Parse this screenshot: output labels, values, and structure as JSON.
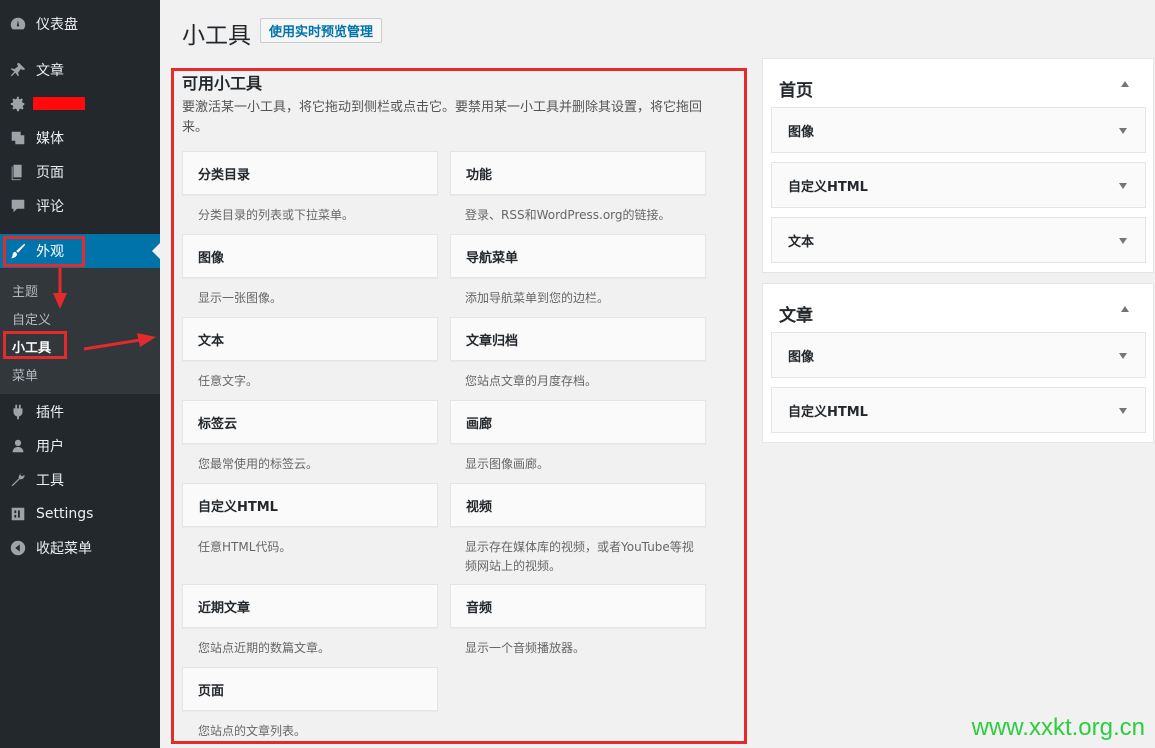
{
  "sidebar": {
    "dashboard": "仪表盘",
    "posts": "文章",
    "media": "媒体",
    "pages": "页面",
    "comments": "评论",
    "appearance": "外观",
    "plugins": "插件",
    "users": "用户",
    "tools": "工具",
    "settings": "Settings",
    "collapse": "收起菜单",
    "submenu": {
      "themes": "主题",
      "customize": "自定义",
      "widgets": "小工具",
      "menus": "菜单"
    }
  },
  "header": {
    "title": "小工具",
    "manage_button": "使用实时预览管理"
  },
  "available": {
    "title": "可用小工具",
    "description": "要激活某一小工具，将它拖动到侧栏或点击它。要禁用某一小工具并删除其设置，将它拖回来。",
    "widgets": [
      {
        "name": "分类目录",
        "desc": "分类目录的列表或下拉菜单。"
      },
      {
        "name": "功能",
        "desc": "登录、RSS和WordPress.org的链接。"
      },
      {
        "name": "图像",
        "desc": "显示一张图像。"
      },
      {
        "name": "导航菜单",
        "desc": "添加导航菜单到您的边栏。"
      },
      {
        "name": "文本",
        "desc": "任意文字。"
      },
      {
        "name": "文章归档",
        "desc": "您站点文章的月度存档。"
      },
      {
        "name": "标签云",
        "desc": "您最常使用的标签云。"
      },
      {
        "name": "画廊",
        "desc": "显示图像画廊。"
      },
      {
        "name": "自定义HTML",
        "desc": "任意HTML代码。"
      },
      {
        "name": "视频",
        "desc": "显示存在媒体库的视频，或者YouTube等视频网站上的视频。"
      },
      {
        "name": "近期文章",
        "desc": "您站点近期的数篇文章。"
      },
      {
        "name": "音频",
        "desc": "显示一个音频播放器。"
      },
      {
        "name": "页面",
        "desc": "您站点的文章列表。"
      }
    ]
  },
  "sidebars": [
    {
      "title": "首页",
      "widgets": [
        "图像",
        "自定义HTML",
        "文本"
      ]
    },
    {
      "title": "文章",
      "widgets": [
        "图像",
        "自定义HTML"
      ]
    }
  ],
  "watermark": "www.xxkt.org.cn",
  "colors": {
    "accent": "#0073aa",
    "sidebar_bg": "#23282d",
    "highlight_red": "#e32b2b",
    "watermark_green": "#2ecc40"
  }
}
